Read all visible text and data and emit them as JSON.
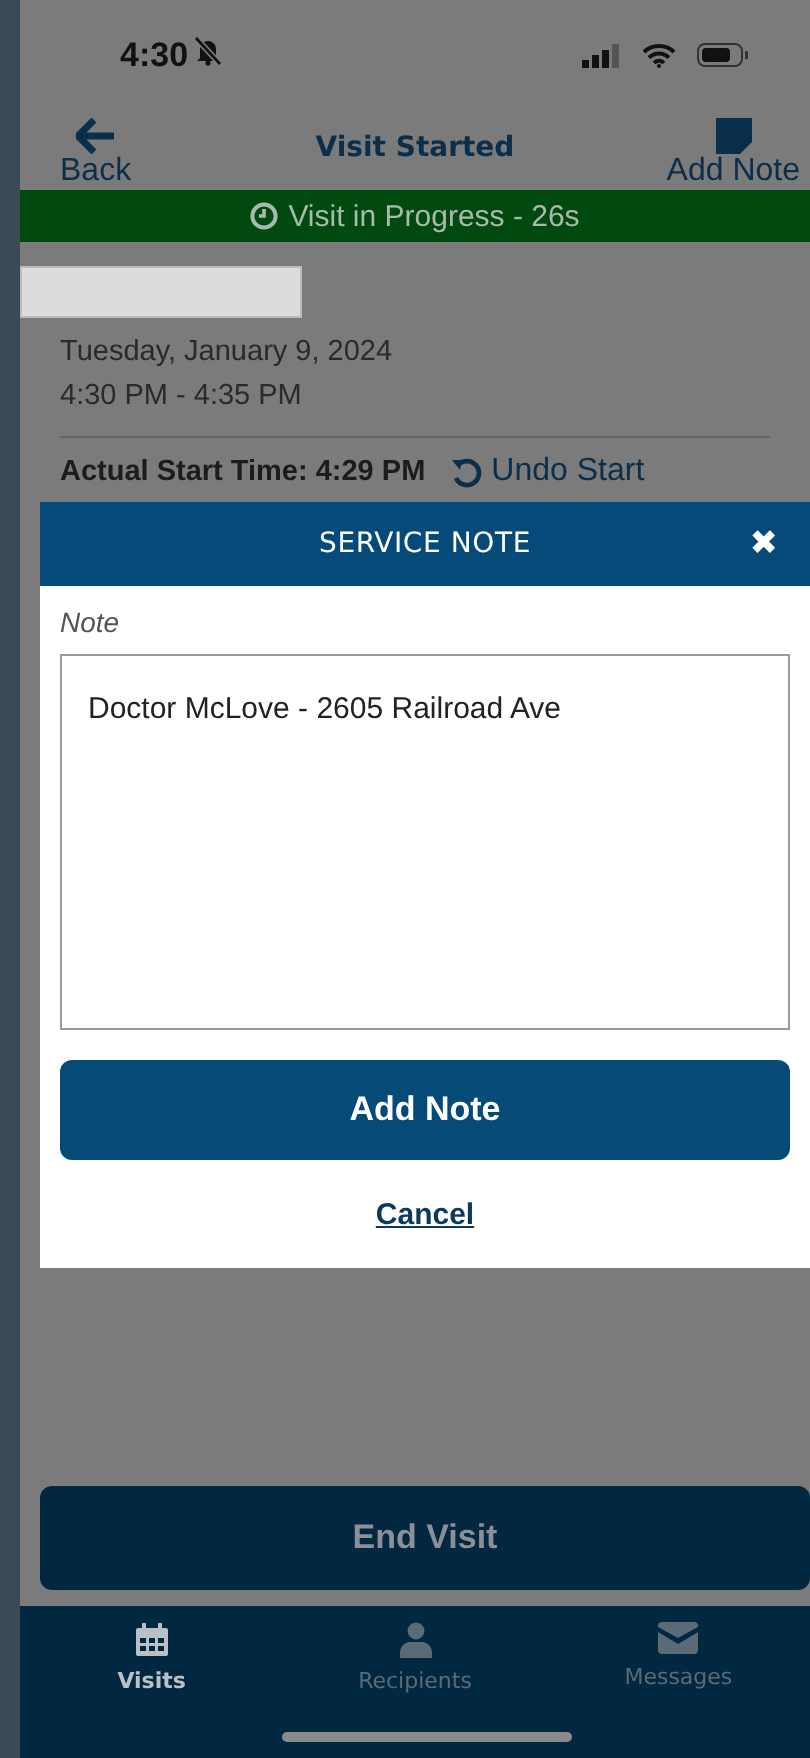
{
  "status_bar": {
    "time": "4:30",
    "muted": true
  },
  "header": {
    "back": "Back",
    "title": "Visit Started",
    "add_note": "Add Note"
  },
  "banner": {
    "text": "Visit in Progress - 26s"
  },
  "visit": {
    "date": "Tuesday, January 9, 2024",
    "time_range": "4:30 PM - 4:35 PM",
    "actual_start": "Actual Start Time: 4:29 PM",
    "undo": "Undo Start"
  },
  "modal": {
    "title": "SERVICE NOTE",
    "close": "✖",
    "note_label": "Note",
    "note_value": "Doctor McLove - 2605 Railroad Ave",
    "submit": "Add Note",
    "cancel": "Cancel"
  },
  "end_visit": "End Visit",
  "tabs": [
    {
      "label": "Visits",
      "selected": true
    },
    {
      "label": "Recipients",
      "selected": false
    },
    {
      "label": "Messages",
      "selected": false
    }
  ]
}
